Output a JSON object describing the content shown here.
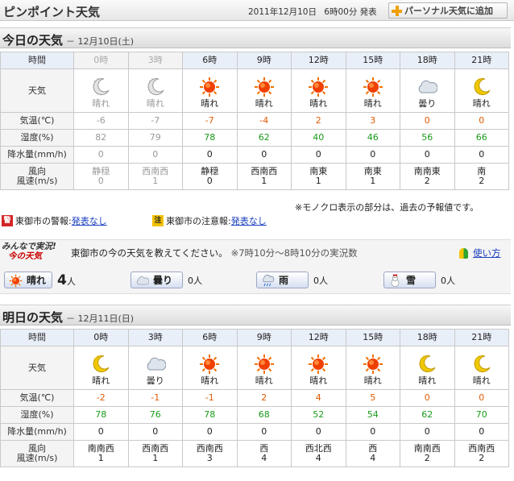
{
  "header": {
    "title": "ピンポイント天気",
    "issued_date": "2011年12月10日",
    "issued_time": "6時00分 発表",
    "personal_button": "パーソナル天気に追加"
  },
  "today": {
    "heading": "今日の天気",
    "date": "－ 12月10日(土)",
    "labels": {
      "time": "時間",
      "weather": "天気",
      "temp": "気温(℃)",
      "humidity": "湿度(%)",
      "rain": "降水量(mm/h)",
      "wind_dir": "風向",
      "wind_speed": "風速(m/s)"
    },
    "columns": [
      {
        "hour": "0時",
        "past": true,
        "icon": "moon-icon",
        "weather": "晴れ",
        "temp": "-6",
        "humidity": "82",
        "rain": "0",
        "wind_dir": "静穏",
        "wind_speed": "0"
      },
      {
        "hour": "3時",
        "past": true,
        "icon": "moon-icon",
        "weather": "晴れ",
        "temp": "-7",
        "humidity": "79",
        "rain": "0",
        "wind_dir": "西南西",
        "wind_speed": "1"
      },
      {
        "hour": "6時",
        "past": false,
        "icon": "sun-icon",
        "weather": "晴れ",
        "temp": "-7",
        "humidity": "78",
        "rain": "0",
        "wind_dir": "静穏",
        "wind_speed": "0"
      },
      {
        "hour": "9時",
        "past": false,
        "icon": "sun-icon",
        "weather": "晴れ",
        "temp": "-4",
        "humidity": "62",
        "rain": "0",
        "wind_dir": "西南西",
        "wind_speed": "1"
      },
      {
        "hour": "12時",
        "past": false,
        "icon": "sun-icon",
        "weather": "晴れ",
        "temp": "2",
        "humidity": "40",
        "rain": "0",
        "wind_dir": "南東",
        "wind_speed": "1"
      },
      {
        "hour": "15時",
        "past": false,
        "icon": "sun-icon",
        "weather": "晴れ",
        "temp": "3",
        "humidity": "46",
        "rain": "0",
        "wind_dir": "南東",
        "wind_speed": "1"
      },
      {
        "hour": "18時",
        "past": false,
        "icon": "cloud-icon",
        "weather": "曇り",
        "temp": "0",
        "humidity": "56",
        "rain": "0",
        "wind_dir": "南南東",
        "wind_speed": "2"
      },
      {
        "hour": "21時",
        "past": false,
        "icon": "moon-icon",
        "weather": "晴れ",
        "temp": "0",
        "humidity": "66",
        "rain": "0",
        "wind_dir": "南",
        "wind_speed": "2"
      }
    ]
  },
  "note": "※モノクロ表示の部分は、過去の予報値です。",
  "alerts": {
    "warning_badge": "警",
    "warning_label": "東御市の警報:",
    "warning_value": "発表なし",
    "advisory_badge": "注",
    "advisory_label": "東御市の注意報:",
    "advisory_value": "発表なし"
  },
  "report": {
    "logo_line1": "みんなで実況!",
    "logo_line2": "今の天気",
    "prompt": "東御市の今の天気を教えてください。",
    "range": "※7時10分～8時10分の実況数",
    "howto": "使い方",
    "votes": [
      {
        "label": "晴れ",
        "icon": "sun-icon",
        "count": "4",
        "unit": "人"
      },
      {
        "label": "曇り",
        "icon": "cloud-icon",
        "count": "0",
        "unit": "人"
      },
      {
        "label": "雨",
        "icon": "rain-icon",
        "count": "0",
        "unit": "人"
      },
      {
        "label": "雪",
        "icon": "snowman-icon",
        "count": "0",
        "unit": "人"
      }
    ]
  },
  "tomorrow": {
    "heading": "明日の天気",
    "date": "－ 12月11日(日)",
    "labels": {
      "time": "時間",
      "weather": "天気",
      "temp": "気温(℃)",
      "humidity": "湿度(%)",
      "rain": "降水量(mm/h)",
      "wind_dir": "風向",
      "wind_speed": "風速(m/s)"
    },
    "columns": [
      {
        "hour": "0時",
        "past": false,
        "icon": "moon-icon",
        "weather": "晴れ",
        "temp": "-2",
        "humidity": "78",
        "rain": "0",
        "wind_dir": "南南西",
        "wind_speed": "1"
      },
      {
        "hour": "3時",
        "past": false,
        "icon": "cloud-icon",
        "weather": "曇り",
        "temp": "-1",
        "humidity": "76",
        "rain": "0",
        "wind_dir": "西南西",
        "wind_speed": "1"
      },
      {
        "hour": "6時",
        "past": false,
        "icon": "sun-icon",
        "weather": "晴れ",
        "temp": "-1",
        "humidity": "78",
        "rain": "0",
        "wind_dir": "西南西",
        "wind_speed": "3"
      },
      {
        "hour": "9時",
        "past": false,
        "icon": "sun-icon",
        "weather": "晴れ",
        "temp": "2",
        "humidity": "68",
        "rain": "0",
        "wind_dir": "西",
        "wind_speed": "4"
      },
      {
        "hour": "12時",
        "past": false,
        "icon": "sun-icon",
        "weather": "晴れ",
        "temp": "4",
        "humidity": "52",
        "rain": "0",
        "wind_dir": "西北西",
        "wind_speed": "4"
      },
      {
        "hour": "15時",
        "past": false,
        "icon": "sun-icon",
        "weather": "晴れ",
        "temp": "5",
        "humidity": "54",
        "rain": "0",
        "wind_dir": "西",
        "wind_speed": "4"
      },
      {
        "hour": "18時",
        "past": false,
        "icon": "moon-icon",
        "weather": "晴れ",
        "temp": "0",
        "humidity": "62",
        "rain": "0",
        "wind_dir": "南南西",
        "wind_speed": "2"
      },
      {
        "hour": "21時",
        "past": false,
        "icon": "moon-icon",
        "weather": "晴れ",
        "temp": "0",
        "humidity": "70",
        "rain": "0",
        "wind_dir": "西南西",
        "wind_speed": "2"
      }
    ]
  },
  "colors": {
    "temp": "#e05a00",
    "humidity": "#1a9a1a",
    "past": "#999999",
    "link": "#1a3fbf",
    "hour_header": "#e9eff9"
  }
}
